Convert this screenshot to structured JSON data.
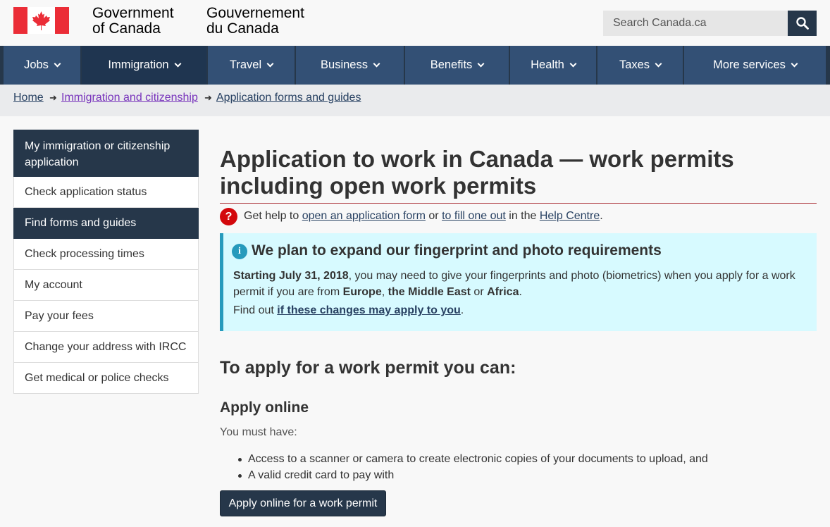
{
  "header": {
    "signature_en": [
      "Government",
      "of Canada"
    ],
    "signature_fr": [
      "Gouvernement",
      "du Canada"
    ],
    "search_placeholder": "Search Canada.ca",
    "search_icon": "magnifier-icon",
    "flag_color": "#eb2d37"
  },
  "menu": {
    "items": [
      {
        "label": "Jobs"
      },
      {
        "label": "Immigration"
      },
      {
        "label": "Travel"
      },
      {
        "label": "Business"
      },
      {
        "label": "Benefits"
      },
      {
        "label": "Health"
      },
      {
        "label": "Taxes"
      },
      {
        "label": "More services"
      }
    ],
    "active": "Immigration"
  },
  "breadcrumb": {
    "home": "Home",
    "immigration": "Immigration and citizenship",
    "forms": "Application forms and guides"
  },
  "sidebar": {
    "items": [
      {
        "label": "My immigration or citizenship application"
      },
      {
        "label": "Check application status"
      },
      {
        "label": "Find forms and guides"
      },
      {
        "label": "Check processing times"
      },
      {
        "label": "My account"
      },
      {
        "label": "Pay your fees"
      },
      {
        "label": "Change your address with IRCC"
      },
      {
        "label": "Get medical or police checks"
      }
    ]
  },
  "main": {
    "title": "Application to work in Canada — work permits including open work permits",
    "help": {
      "prefix": "Get help to ",
      "link1": "open an application form",
      "mid": " or ",
      "link2": "to fill one out",
      "mid2": " in the ",
      "link3": "Help Centre",
      "suffix": "."
    },
    "alert": {
      "heading": "We plan to expand our fingerprint and photo requirements",
      "date": "Starting July 31, 2018",
      "text1": ", you may need to give your fingerprints and photo (biometrics) when you apply for a work permit if you are from ",
      "region1": "Europe",
      "sep1": ", ",
      "region2": "the Middle East",
      "sep2": " or ",
      "region3": "Africa",
      "end": ".",
      "find_prefix": "Find out ",
      "find_link": "if these changes may apply to you",
      "find_suffix": "."
    },
    "h2": "To apply for a work permit you can:",
    "h3": "Apply online",
    "must": "You must have:",
    "requirements": [
      "Access to a scanner or camera to create electronic copies of your documents to upload, and",
      "A valid credit card to pay with"
    ],
    "apply_button": "Apply online for a work permit"
  }
}
